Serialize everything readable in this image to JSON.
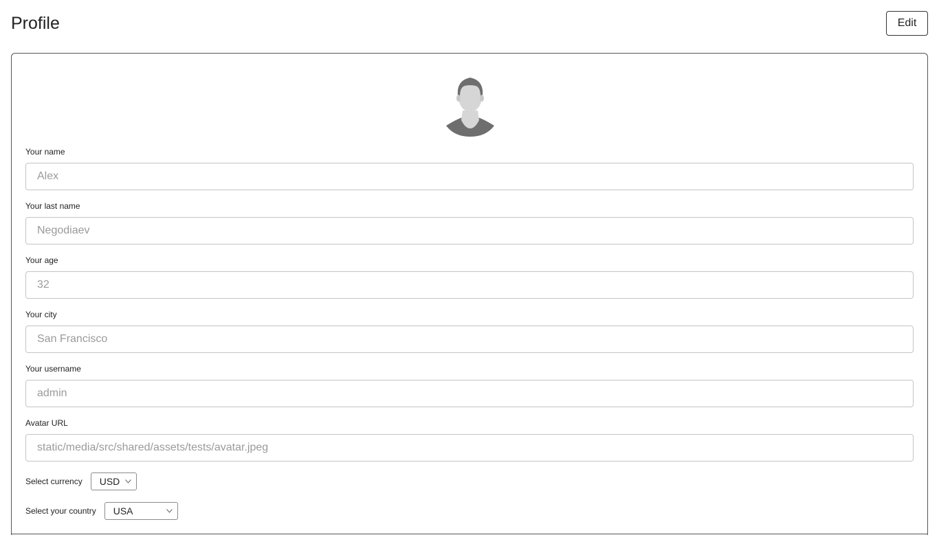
{
  "header": {
    "title": "Profile",
    "edit_label": "Edit"
  },
  "form": {
    "fields": [
      {
        "label": "Your name",
        "value": "Alex"
      },
      {
        "label": "Your last name",
        "value": "Negodiaev"
      },
      {
        "label": "Your age",
        "value": "32"
      },
      {
        "label": "Your city",
        "value": "San Francisco"
      },
      {
        "label": "Your username",
        "value": "admin"
      },
      {
        "label": "Avatar URL",
        "value": "static/media/src/shared/assets/tests/avatar.jpeg"
      }
    ],
    "currency": {
      "label": "Select currency",
      "value": "USD"
    },
    "country": {
      "label": "Select your country",
      "value": "USA"
    }
  },
  "colors": {
    "border": "#c4c4c4",
    "placeholder_text": "#9a9a9a",
    "avatar_dark": "#6e6e6e",
    "avatar_light": "#d6d6d6"
  }
}
